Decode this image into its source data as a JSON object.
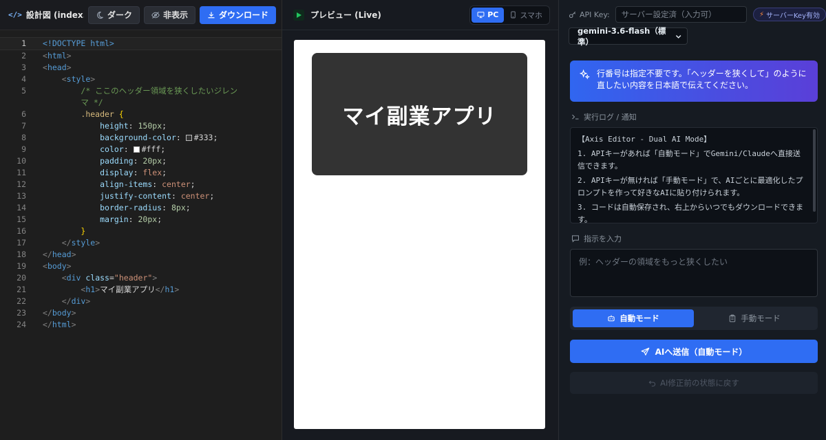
{
  "editor": {
    "title": "設計図 (index.ht…",
    "btn_dark": "ダーク",
    "btn_hide": "非表示",
    "btn_download": "ダウンロード",
    "lines": [
      {
        "n": "1"
      },
      {
        "n": "2"
      },
      {
        "n": "3"
      },
      {
        "n": "4"
      },
      {
        "n": "5"
      },
      {
        "n": ""
      },
      {
        "n": "6"
      },
      {
        "n": "7"
      },
      {
        "n": "8"
      },
      {
        "n": "9"
      },
      {
        "n": "10"
      },
      {
        "n": "11"
      },
      {
        "n": "12"
      },
      {
        "n": "13"
      },
      {
        "n": "14"
      },
      {
        "n": "15"
      },
      {
        "n": "16"
      },
      {
        "n": "17"
      },
      {
        "n": "18"
      },
      {
        "n": "19"
      },
      {
        "n": "20"
      },
      {
        "n": "21"
      },
      {
        "n": "22"
      },
      {
        "n": "23"
      },
      {
        "n": "24"
      }
    ],
    "code": {
      "doctype": "<!DOCTYPE html>",
      "html_open": "html",
      "head_open": "head",
      "style_open": "style",
      "comment_1": "/* ここのヘッダー領域を狭くしたいジレン",
      "comment_2": "マ */",
      "selector": ".header",
      "brace_open": "{",
      "brace_close": "}",
      "props": [
        {
          "name": "height",
          "value": "150px",
          "kind": "num"
        },
        {
          "name": "background-color",
          "value": "#333",
          "kind": "color",
          "swatch": "#333333"
        },
        {
          "name": "color",
          "value": "#fff",
          "kind": "color",
          "swatch": "#ffffff"
        },
        {
          "name": "padding",
          "value": "20px",
          "kind": "num"
        },
        {
          "name": "display",
          "value": "flex",
          "kind": "kw"
        },
        {
          "name": "align-items",
          "value": "center",
          "kind": "kw"
        },
        {
          "name": "justify-content",
          "value": "center",
          "kind": "kw"
        },
        {
          "name": "border-radius",
          "value": "8px",
          "kind": "num"
        },
        {
          "name": "margin",
          "value": "20px",
          "kind": "num"
        }
      ],
      "style_close": "style",
      "head_close": "head",
      "body_open": "body",
      "div_tag": "div",
      "class_attr": "class",
      "class_value": "\"header\"",
      "h1_tag": "h1",
      "h1_text": "マイ副業アプリ",
      "div_close": "div",
      "body_close": "body",
      "html_close": "html"
    }
  },
  "preview": {
    "title": "プレビュー (Live)",
    "btn_pc": "PC",
    "btn_phone": "スマホ",
    "heading": "マイ副業アプリ"
  },
  "panel": {
    "api_label": "API Key:",
    "api_placeholder": "サーバー設定済（入力可）",
    "server_badge": "サーバーKey有効",
    "model": "gemini-3.6-flash（標準）",
    "hint": "行番号は指定不要です。「ヘッダーを狭くして」のように直したい内容を日本語で伝えてください。",
    "log_label": "実行ログ / 通知",
    "log": [
      "【Axis Editor - Dual AI Mode】",
      "1. APIキーがあれば「自動モード」でGemini/Claudeへ直接送信できます。",
      "2. APIキーが無ければ「手動モード」で、AIごとに最適化したプロンプトを作って好きなAIに貼り付けられます。",
      "3. コードは自動保存され、右上からいつでもダウンロードできます。"
    ],
    "instr_label": "指示を入力",
    "instr_placeholder": "例：ヘッダーの領域をもっと狭くしたい",
    "mode_auto": "自動モード",
    "mode_manual": "手動モード",
    "send": "AIへ送信（自動モード）",
    "revert": "AI修正前の状態に戻す"
  },
  "colors": {
    "accent": "#2f6df3",
    "editor_bg": "#1e1e1e",
    "panel_bg": "#161b22",
    "preview_header": "#333333"
  }
}
